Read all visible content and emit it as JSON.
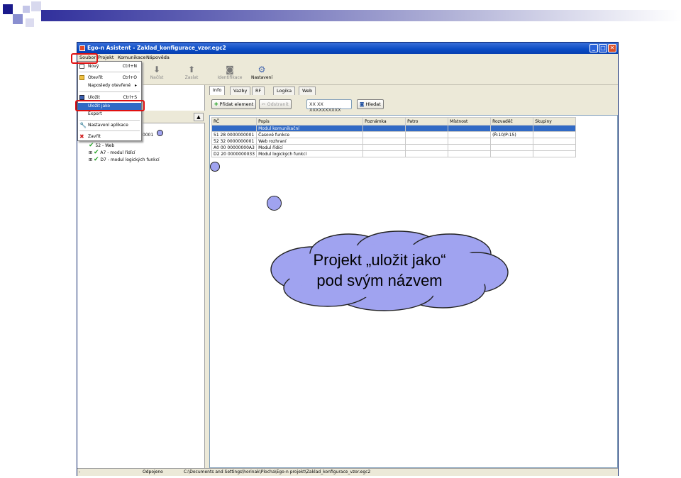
{
  "window": {
    "title": "Ego-n Asistent - Zaklad_konfigurace_vzor.egc2"
  },
  "menubar": [
    "Soubor",
    "Projekt",
    "Komunikace",
    "Nápověda"
  ],
  "toolbar": [
    {
      "label": "Načíst",
      "icon": "arrow-down-icon"
    },
    {
      "label": "Zaslat",
      "icon": "arrow-up-icon"
    },
    {
      "label": "Identifikace",
      "icon": "binoculars-icon"
    },
    {
      "label": "Nastavení",
      "icon": "gear-icon"
    }
  ],
  "file_menu": {
    "items": [
      {
        "label": "Nový",
        "shortcut": "Ctrl+N",
        "icon": "new-file-icon"
      },
      {
        "label": "Otevřít",
        "shortcut": "Ctrl+O",
        "icon": "folder-icon"
      },
      {
        "label": "Naposledy otevřené",
        "shortcut": "▸",
        "icon": ""
      },
      {
        "label": "Uložit",
        "shortcut": "Ctrl+S",
        "icon": "save-icon"
      },
      {
        "label": "Uložit jako",
        "shortcut": "",
        "icon": ""
      },
      {
        "label": "Export",
        "shortcut": "",
        "icon": ""
      },
      {
        "label": "Nastavení aplikace",
        "shortcut": "",
        "icon": "wrench-icon"
      },
      {
        "label": "Zavřít",
        "shortcut": "",
        "icon": "close-icon"
      }
    ]
  },
  "tree": {
    "root_suffix": "0001",
    "items": [
      "52 - Web",
      "A7 - modul řídící",
      "D7 - modul logických funkcí"
    ]
  },
  "tabs": [
    "Info",
    "Vazby",
    "RF",
    "Logika",
    "Web"
  ],
  "actions": {
    "add": "Přidat element",
    "remove": "Odstranit",
    "address_placeholder": "XX XX XXXXXXXXXX",
    "search": "Hledat"
  },
  "table": {
    "columns": [
      "RČ",
      "Popis",
      "Poznámka",
      "Patro",
      "Místnost",
      "Rozvaděč",
      "Skupiny"
    ],
    "rows": [
      [
        "",
        "Modul komunikační",
        "",
        "",
        "",
        "",
        ""
      ],
      [
        "51 28 0000000001",
        "Časové funkce",
        "",
        "",
        "",
        "(Ř:10/P:15)",
        ""
      ],
      [
        "52 32 0000000001",
        "Web rozhraní",
        "",
        "",
        "",
        "",
        ""
      ],
      [
        "A0 00 00000000A3",
        "Modul řídící",
        "",
        "",
        "",
        "",
        ""
      ],
      [
        "D2 20 0000000033",
        "Modul logických funkcí",
        "",
        "",
        "",
        "",
        ""
      ]
    ]
  },
  "status": {
    "left": "-",
    "connection": "Odpojeno",
    "path": "C:\\Documents and Settings\\horinak\\Plocha\\Ego-n projekt\\Zaklad_konfigurace_vzor.egc2"
  },
  "callout": {
    "text": "Projekt „uložit jako“ pod svým názvem"
  },
  "colors": {
    "highlight": "#316ac5",
    "annotation_red": "#e01010",
    "cloud_fill": "#a0a3f0"
  }
}
